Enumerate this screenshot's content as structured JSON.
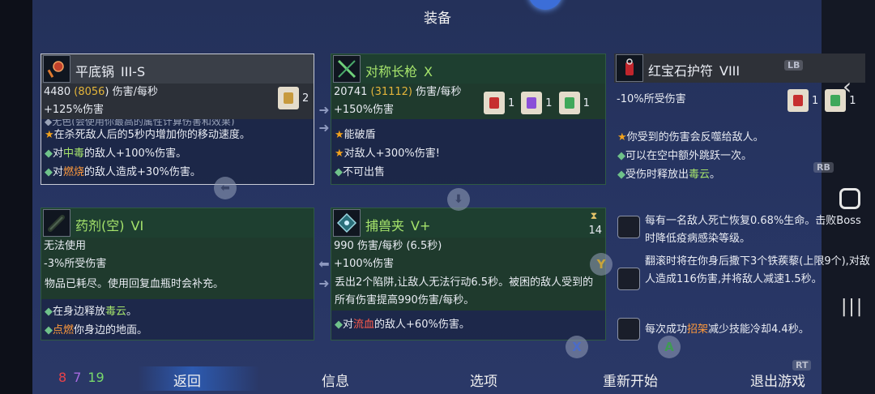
{
  "screen_title": "装备",
  "items": [
    {
      "name": "平底锅",
      "level": "III-S",
      "dps": "4480",
      "dps_alt": "(8056)",
      "dps_unit": "伤害/每秒",
      "bonus": "+125%伤害",
      "scroll_count": "2",
      "cut_line": "◆无色(会使用你最高的属性计算伤害和效果)",
      "effects": [
        "在杀死敌人后的5秒内增加你的移动速度。",
        "对中毒的敌人+100%伤害。",
        "对燃烧的敌人造成+30%伤害。"
      ]
    },
    {
      "name": "对称长枪",
      "level": "X",
      "dps": "20741",
      "dps_alt": "(31112)",
      "dps_unit": "伤害/每秒",
      "bonus": "+150%伤害",
      "scroll_counts": [
        "1",
        "1",
        "1"
      ],
      "effects": [
        "能破盾",
        "对敌人+300%伤害!",
        "不可出售"
      ]
    },
    {
      "name": "红宝石护符",
      "level": "VIII",
      "bonus": "-10%所受伤害",
      "scroll_counts": [
        "1",
        "1"
      ],
      "effects": [
        "你受到的伤害会反噬给敌人。",
        "可以在空中额外跳跃一次。",
        "受伤时释放出毒云。"
      ]
    },
    {
      "name": "药剂(空)",
      "level": "VI",
      "line1": "无法使用",
      "line2": "-3%所受伤害",
      "desc": "物品已耗尽。使用回复血瓶时会补充。",
      "effects": [
        "在身边释放毒云。",
        "点燃你身边的地面。"
      ]
    },
    {
      "name": "捕兽夹",
      "level": "V+",
      "dps": "990 伤害/每秒",
      "cooldown": "(6.5秒)",
      "timer": "14",
      "bonus": "+100%伤害",
      "desc": "丢出2个陷阱,让敌人无法行动6.5秒。被困的敌人受到的所有伤害提高990伤害/每秒。",
      "effects": [
        "对流血的敌人+60%伤害。"
      ]
    }
  ],
  "mutations": [
    "每有一名敌人死亡恢复0.68%生命。击败Boss时降低疫病感染等级。",
    "翻滚时将在你身后撒下3个铁蒺藜(上限9个),对敌人造成116伤害,并将敌人减速1.5秒。",
    "每次成功招架减少技能冷却4.4秒。"
  ],
  "button_hints": {
    "lb": "LB",
    "rb": "RB",
    "rt": "RT",
    "x": "X",
    "a": "A",
    "y": "Y"
  },
  "cells": [
    "8",
    "7",
    "19"
  ],
  "nav": {
    "back": "返回",
    "info": "信息",
    "options": "选项",
    "restart": "重新开始",
    "quit": "退出游戏"
  },
  "colors": {
    "accent_green": "#2f5a43",
    "gold": "#e4b53a",
    "keyword_red": "#ff5a4a",
    "keyword_green": "#a5e36b"
  }
}
